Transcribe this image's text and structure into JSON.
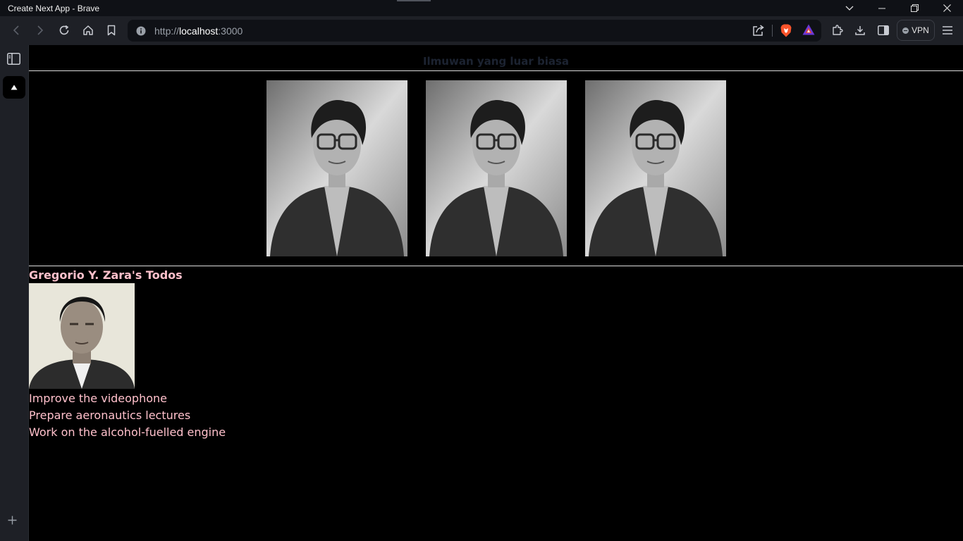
{
  "window": {
    "title": "Create Next App - Brave"
  },
  "toolbar": {
    "url_scheme": "http://",
    "url_host": "localhost",
    "url_port": ":3000",
    "vpn_label": "VPN"
  },
  "page": {
    "heading": "Ilmuwan yang luar biasa",
    "gallery": [
      {
        "alt": "Katherine Johnson"
      },
      {
        "alt": "Katherine Johnson"
      },
      {
        "alt": "Katherine Johnson"
      }
    ],
    "todo_title": "Gregorio Y. Zara's Todos",
    "avatar_alt": "Gregorio Y. Zara",
    "todos": [
      "Improve the videophone",
      "Prepare aeronautics lectures",
      "Work on the alcohol-fuelled engine"
    ]
  },
  "colors": {
    "todo_text": "#ffc0cb",
    "page_bg": "#000000",
    "chrome_bg": "#1e2026"
  }
}
